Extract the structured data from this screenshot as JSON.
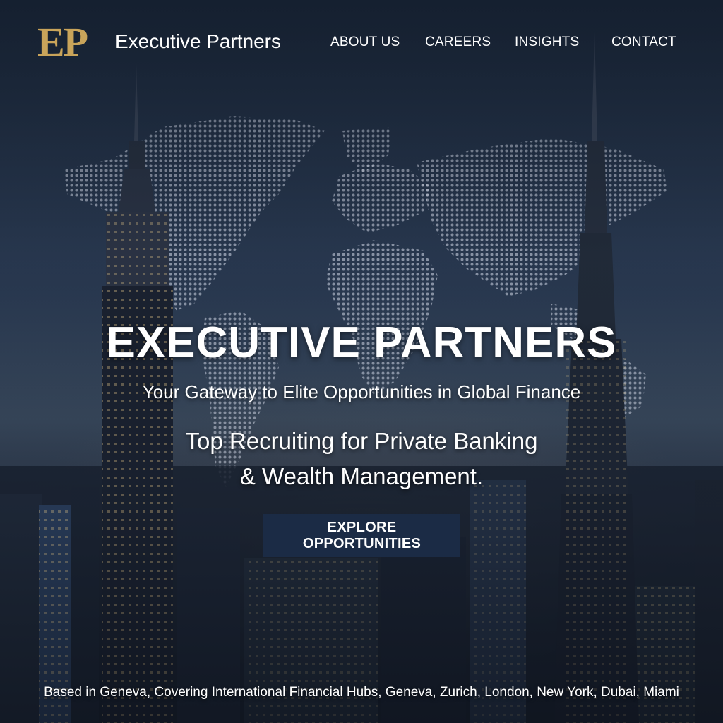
{
  "header": {
    "logo_mark": "EP",
    "brand_name": "Executive Partners",
    "nav": [
      {
        "label": "ABOUT US"
      },
      {
        "label": "CAREERS"
      },
      {
        "label": "INSIGHTS"
      },
      {
        "label": "CONTACT"
      }
    ]
  },
  "hero": {
    "title": "EXECUTIVE PARTNERS",
    "tagline": "Your Gateway to Elite Opportunities in Global Finance",
    "subline_1": "Top Recruiting for Private Banking",
    "subline_2": "& Wealth Management.",
    "cta_label": "EXPLORE OPPORTUNITIES"
  },
  "footer": {
    "locations_text": "Based in Geneva, Covering International Financial Hubs, Geneva, Zurich, London, New York, Dubai, Miami"
  },
  "colors": {
    "gold_accent": "#c9a45a",
    "cta_background": "#1b2b45",
    "sky_top": "#1e2b3e",
    "text": "#ffffff"
  }
}
